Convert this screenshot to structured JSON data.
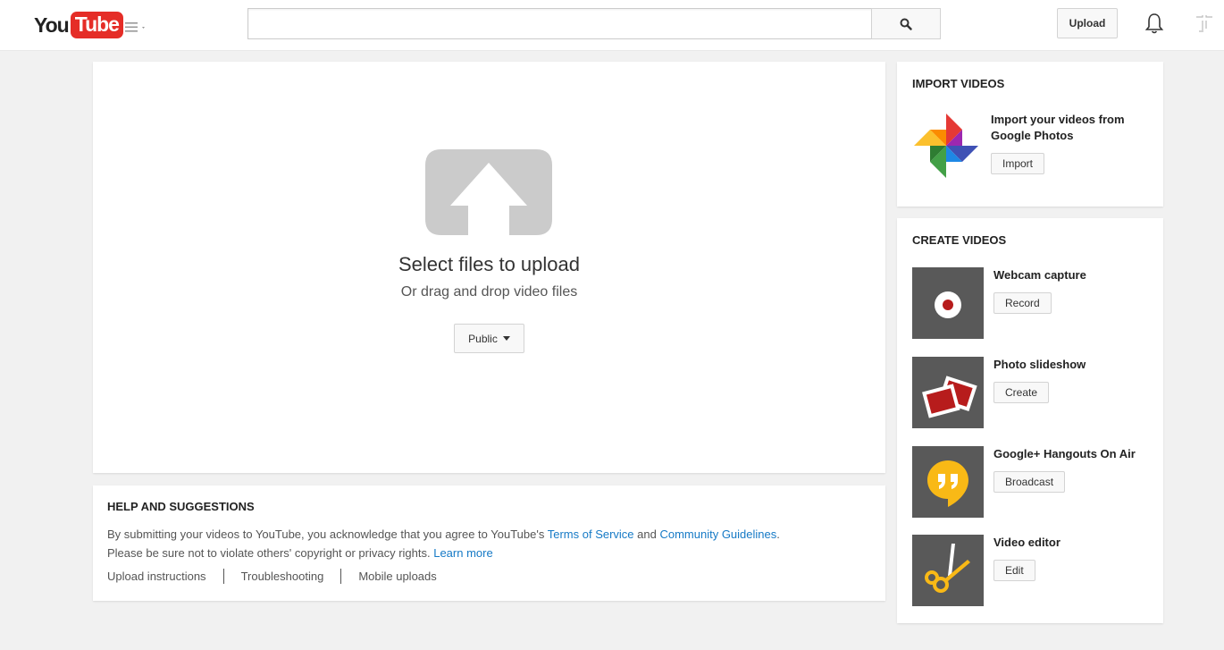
{
  "header": {
    "logo_you": "You",
    "logo_tube": "Tube",
    "search_value": "",
    "upload_label": "Upload"
  },
  "upload": {
    "title": "Select files to upload",
    "subtitle": "Or drag and drop video files",
    "privacy_value": "Public"
  },
  "help": {
    "title": "HELP AND SUGGESTIONS",
    "text_1": "By submitting your videos to YouTube, you acknowledge that you agree to YouTube's ",
    "tos": "Terms of Service",
    "and": " and ",
    "guidelines": "Community Guidelines",
    "period": ".",
    "text_2": "Please be sure not to violate others' copyright or privacy rights. ",
    "learn_more": "Learn more",
    "links": [
      "Upload instructions",
      "Troubleshooting",
      "Mobile uploads"
    ]
  },
  "import": {
    "title": "IMPORT VIDEOS",
    "text": "Import your videos from Google Photos",
    "button": "Import"
  },
  "create": {
    "title": "CREATE VIDEOS",
    "items": [
      {
        "label": "Webcam capture",
        "button": "Record",
        "icon": "webcam-record-icon"
      },
      {
        "label": "Photo slideshow",
        "button": "Create",
        "icon": "photo-slideshow-icon"
      },
      {
        "label": "Google+ Hangouts On Air",
        "button": "Broadcast",
        "icon": "hangouts-icon"
      },
      {
        "label": "Video editor",
        "button": "Edit",
        "icon": "scissors-icon"
      }
    ]
  },
  "colors": {
    "brand_red": "#e52d27",
    "link_blue": "#167ac6",
    "thumb_gray": "#595959"
  }
}
